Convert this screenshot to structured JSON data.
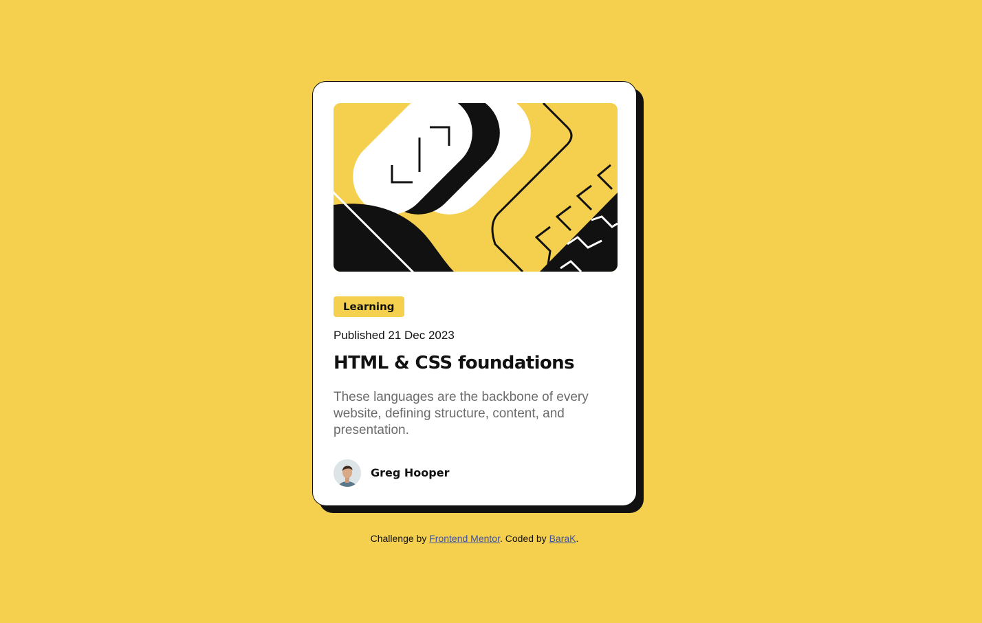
{
  "card": {
    "category": "Learning",
    "published": "Published 21 Dec 2023",
    "title": "HTML & CSS foundations",
    "description": "These languages are the backbone of every website, defining structure, content, and presentation.",
    "author": {
      "name": "Greg Hooper",
      "avatar_icon": "author-avatar"
    },
    "illustration_icon": "abstract-illustration"
  },
  "attribution": {
    "prefix": "Challenge by ",
    "mentor_link": "Frontend Mentor",
    "middle": ". Coded by ",
    "author_link": "BaraK",
    "suffix": "."
  },
  "colors": {
    "background": "#f4d04e",
    "card": "#ffffff",
    "text": "#111111",
    "muted": "#6b6b6b",
    "link": "#3e52a3"
  }
}
